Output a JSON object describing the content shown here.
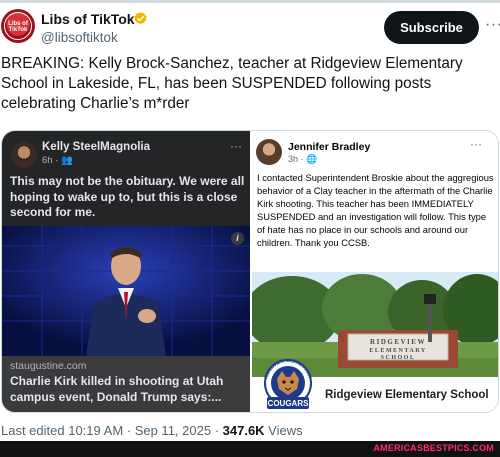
{
  "account": {
    "display_name": "Libs of TikTok",
    "handle": "@libsoftiktok",
    "avatar_text": "Libs of TikTok",
    "verified_color": "#F4B400"
  },
  "actions": {
    "subscribe_label": "Subscribe",
    "more_label": "···"
  },
  "tweet": {
    "text": "BREAKING: Kelly Brock-Sanchez, teacher at Ridgeview Elementary School in Lakeside, FL, has been SUSPENDED following posts celebrating Charlie’s m*rder"
  },
  "left_post": {
    "author": "Kelly SteelMagnolia",
    "meta": "6h · 👥",
    "more": "···",
    "text": "This may not be the obituary. We were all hoping to wake up to, but this is a close second for me.",
    "info_icon": "i",
    "link_source": "staugustine.com",
    "link_headline": "Charlie Kirk killed in shooting at Utah campus event, Donald Trump says:..."
  },
  "right_post": {
    "author": "Jennifer Bradley",
    "meta": "3h · 🌐",
    "more": "···",
    "text": "I contacted Superintendent Broskie about the aggregious behavior of a Clay teacher in the aftermath of the Charlie Kirk shooting. This teacher has been IMMEDIATELY SUSPENDED and an investigation will follow. This type of hate has no place in our schools and around our children. Thank you CCSB.",
    "sign_line1": "RIDGEVIEW",
    "sign_line2": "ELEMENTARY",
    "sign_line3": "SCHOOL",
    "logo_ring_text": "RIDGEVIEW ELEMENTARY",
    "logo_team": "COUGARS",
    "school_name": "Ridgeview Elementary School"
  },
  "footer": {
    "edited": "Last edited 10:19 AM · Sep 11, 2025 · ",
    "views_count": "347.6K",
    "views_label": " Views"
  },
  "watermark": "AMERICASBESTPICS.COM",
  "colors": {
    "brand_red": "#C8102E",
    "facebook_dark": "#242526",
    "watermark_pink": "#FF2B6E"
  }
}
